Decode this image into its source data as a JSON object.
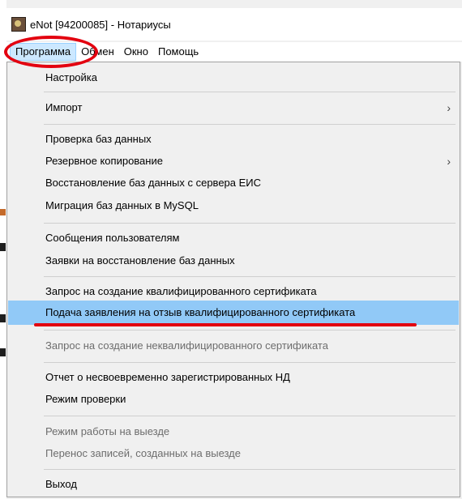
{
  "window": {
    "title": "eNot [94200085] - Нотариусы"
  },
  "menubar": {
    "items": [
      "Программа",
      "Обмен",
      "Окно",
      "Помощь"
    ]
  },
  "dropdown": {
    "items": [
      "Настройка",
      "Импорт",
      "Проверка баз данных",
      "Резервное копирование",
      "Восстановление баз данных с сервера ЕИС",
      "Миграция баз данных в MySQL",
      "Сообщения пользователям",
      "Заявки на восстановление баз данных",
      "Запрос на создание квалифицированного сертификата",
      "Подача заявления на отзыв квалифицированного сертификата",
      "Запрос на создание неквалифицированного сертификата",
      "Отчет о несвоевременно зарегистрированных НД",
      "Режим проверки",
      "Режим работы на выезде",
      "Перенос записей, созданных на выезде",
      "Выход"
    ],
    "submenu_arrow": "›"
  },
  "colors": {
    "highlight": "#91c9f7",
    "annotation": "#e3000f",
    "menu_bg": "#f0f0f0"
  }
}
